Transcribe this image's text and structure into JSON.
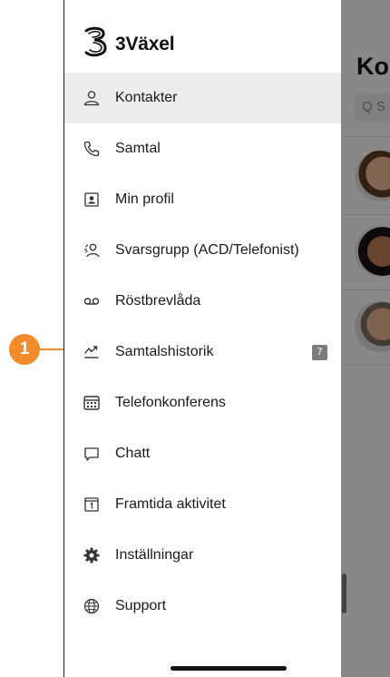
{
  "brand": {
    "name": "3Växel",
    "logo_icon": "three-logo-icon"
  },
  "menu": {
    "items": [
      {
        "label": "Kontakter",
        "icon": "person-icon",
        "active": true
      },
      {
        "label": "Samtal",
        "icon": "phone-icon"
      },
      {
        "label": "Min profil",
        "icon": "profile-card-icon"
      },
      {
        "label": "Svarsgrupp (ACD/Telefonist)",
        "icon": "group-icon"
      },
      {
        "label": "Röstbrevlåda",
        "icon": "voicemail-icon"
      },
      {
        "label": "Samtalshistorik",
        "icon": "call-history-icon",
        "badge": "7"
      },
      {
        "label": "Telefonkonferens",
        "icon": "keypad-icon"
      },
      {
        "label": "Chatt",
        "icon": "chat-bubble-icon"
      },
      {
        "label": "Framtida aktivitet",
        "icon": "calendar-icon"
      },
      {
        "label": "Inställningar",
        "icon": "gear-icon"
      },
      {
        "label": "Support",
        "icon": "globe-icon"
      }
    ]
  },
  "background": {
    "title": "Ko",
    "search_placeholder": "Q S"
  },
  "callout": {
    "number": "1"
  },
  "colors": {
    "accent": "#f28b2c",
    "active_bg": "#ececec",
    "badge_bg": "#7c7c7c"
  }
}
